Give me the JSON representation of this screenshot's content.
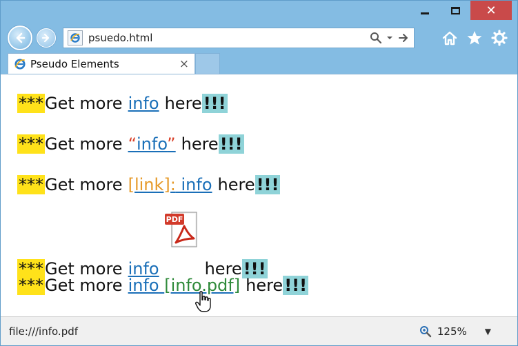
{
  "window": {
    "controls": {
      "minimize": "minimize",
      "maximize": "maximize",
      "close": "✕"
    }
  },
  "nav": {
    "address": "psuedo.html"
  },
  "tab": {
    "title": "Pseudo Elements",
    "close": "×"
  },
  "content": {
    "prefix": "***",
    "get_more": "Get more",
    "here": "here",
    "bangs": "!!!",
    "lines": [
      {
        "link": "info"
      },
      {
        "quote_open": "“",
        "link": "info",
        "quote_close": "”"
      },
      {
        "prefix_link": "[link]:",
        "link": "info"
      },
      {
        "link": "info",
        "icon": "pdf-icon",
        "icon_text": "PDF"
      },
      {
        "link": "info",
        "suffix_link": "[info.pdf]"
      }
    ]
  },
  "status": {
    "url": "file:///info.pdf",
    "zoom": "125%",
    "zoom_dropdown": "▼"
  },
  "colors": {
    "highlight_yellow": "#ffe21a",
    "highlight_cyan": "#8fd3d8",
    "link_blue": "#1a6fb8",
    "quote_red": "#d9412a",
    "link_orange": "#e69a2a",
    "link_green": "#2f8a3a"
  }
}
